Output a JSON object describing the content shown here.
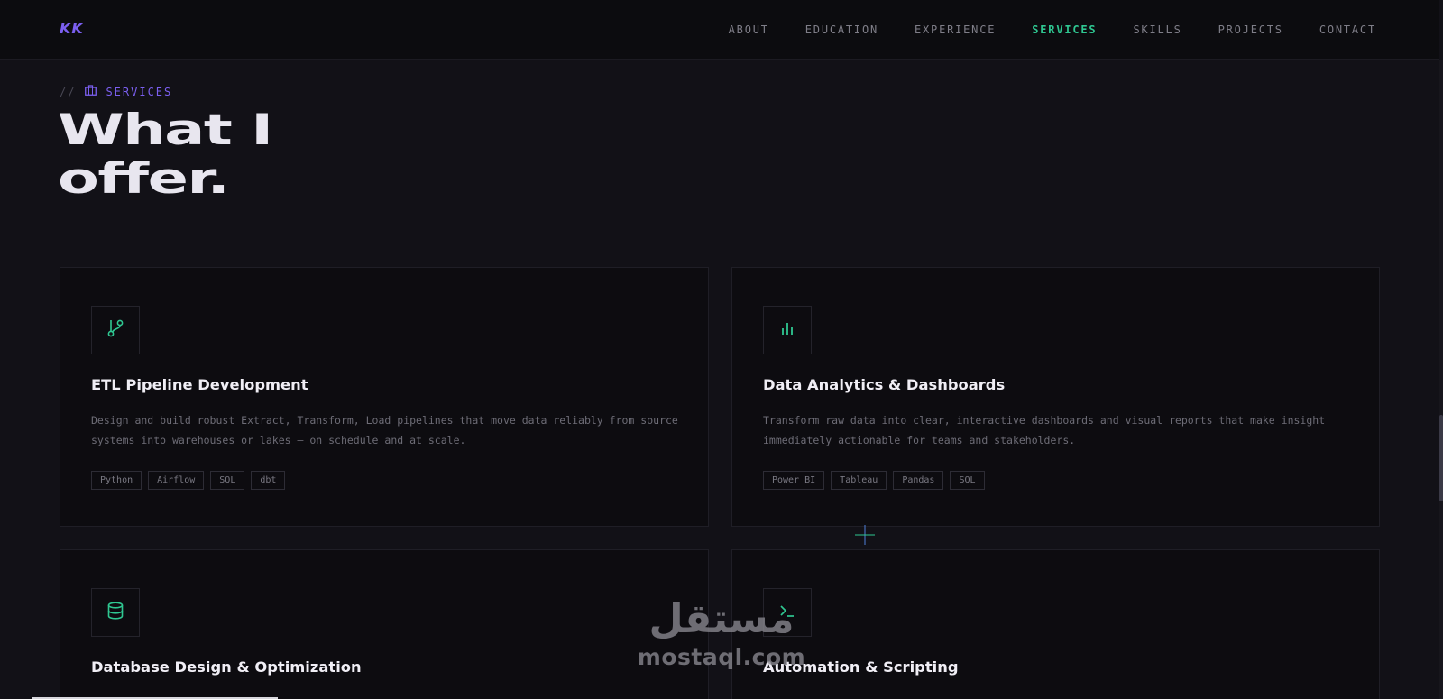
{
  "nav": {
    "logo": "KK",
    "links": [
      "ABOUT",
      "EDUCATION",
      "EXPERIENCE",
      "SERVICES",
      "SKILLS",
      "PROJECTS",
      "CONTACT"
    ],
    "active": "SERVICES"
  },
  "section": {
    "eyebrow_prefix": "//",
    "eyebrow_icon": "briefcase-icon",
    "eyebrow_label": "SERVICES",
    "headline_line1": "What I",
    "headline_line2": "offer."
  },
  "services": [
    {
      "icon": "git-branch-icon",
      "title": "ETL Pipeline Development",
      "description": "Design and build robust Extract, Transform, Load pipelines that move data reliably from source systems into warehouses or lakes — on schedule and at scale.",
      "tags": [
        "Python",
        "Airflow",
        "SQL",
        "dbt"
      ]
    },
    {
      "icon": "bar-chart-icon",
      "title": "Data Analytics & Dashboards",
      "description": "Transform raw data into clear, interactive dashboards and visual reports that make insight immediately actionable for teams and stakeholders.",
      "tags": [
        "Power BI",
        "Tableau",
        "Pandas",
        "SQL"
      ]
    },
    {
      "icon": "database-icon",
      "title": "Database Design & Optimization",
      "description": "",
      "tags": []
    },
    {
      "icon": "terminal-icon",
      "title": "Automation & Scripting",
      "description": "",
      "tags": []
    }
  ],
  "watermark": {
    "arabic": "مستقل",
    "latin": "mostaql.com"
  },
  "colors": {
    "background": "#121117",
    "accent_purple": "#7b5ff0",
    "accent_green": "#2fc791",
    "card_bg": "#0d0c10",
    "text_primary": "#f0eef5",
    "text_muted": "#6d6c76"
  }
}
